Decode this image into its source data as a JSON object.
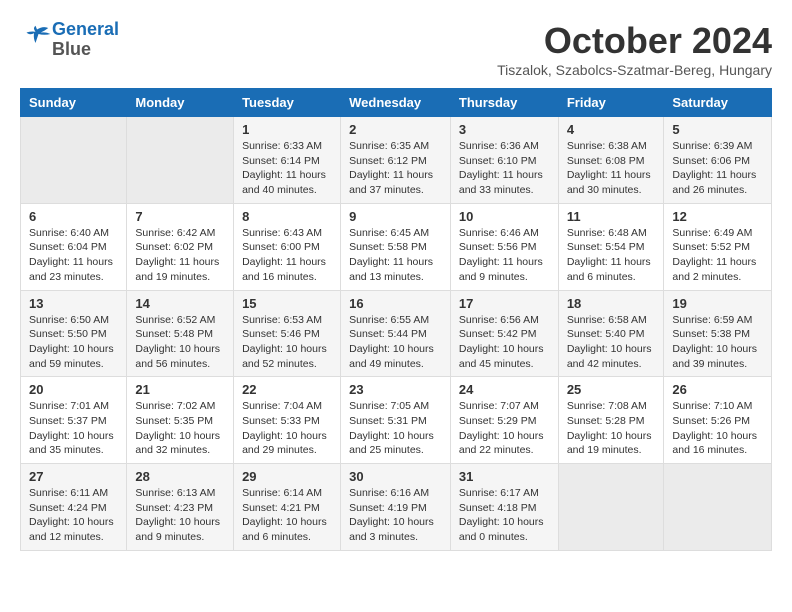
{
  "header": {
    "logo_line1": "General",
    "logo_line2": "Blue",
    "month_title": "October 2024",
    "location": "Tiszalok, Szabolcs-Szatmar-Bereg, Hungary"
  },
  "columns": [
    "Sunday",
    "Monday",
    "Tuesday",
    "Wednesday",
    "Thursday",
    "Friday",
    "Saturday"
  ],
  "weeks": [
    [
      {
        "day": "",
        "empty": true
      },
      {
        "day": "",
        "empty": true
      },
      {
        "day": "1",
        "sunrise": "Sunrise: 6:33 AM",
        "sunset": "Sunset: 6:14 PM",
        "daylight": "Daylight: 11 hours and 40 minutes."
      },
      {
        "day": "2",
        "sunrise": "Sunrise: 6:35 AM",
        "sunset": "Sunset: 6:12 PM",
        "daylight": "Daylight: 11 hours and 37 minutes."
      },
      {
        "day": "3",
        "sunrise": "Sunrise: 6:36 AM",
        "sunset": "Sunset: 6:10 PM",
        "daylight": "Daylight: 11 hours and 33 minutes."
      },
      {
        "day": "4",
        "sunrise": "Sunrise: 6:38 AM",
        "sunset": "Sunset: 6:08 PM",
        "daylight": "Daylight: 11 hours and 30 minutes."
      },
      {
        "day": "5",
        "sunrise": "Sunrise: 6:39 AM",
        "sunset": "Sunset: 6:06 PM",
        "daylight": "Daylight: 11 hours and 26 minutes."
      }
    ],
    [
      {
        "day": "6",
        "sunrise": "Sunrise: 6:40 AM",
        "sunset": "Sunset: 6:04 PM",
        "daylight": "Daylight: 11 hours and 23 minutes."
      },
      {
        "day": "7",
        "sunrise": "Sunrise: 6:42 AM",
        "sunset": "Sunset: 6:02 PM",
        "daylight": "Daylight: 11 hours and 19 minutes."
      },
      {
        "day": "8",
        "sunrise": "Sunrise: 6:43 AM",
        "sunset": "Sunset: 6:00 PM",
        "daylight": "Daylight: 11 hours and 16 minutes."
      },
      {
        "day": "9",
        "sunrise": "Sunrise: 6:45 AM",
        "sunset": "Sunset: 5:58 PM",
        "daylight": "Daylight: 11 hours and 13 minutes."
      },
      {
        "day": "10",
        "sunrise": "Sunrise: 6:46 AM",
        "sunset": "Sunset: 5:56 PM",
        "daylight": "Daylight: 11 hours and 9 minutes."
      },
      {
        "day": "11",
        "sunrise": "Sunrise: 6:48 AM",
        "sunset": "Sunset: 5:54 PM",
        "daylight": "Daylight: 11 hours and 6 minutes."
      },
      {
        "day": "12",
        "sunrise": "Sunrise: 6:49 AM",
        "sunset": "Sunset: 5:52 PM",
        "daylight": "Daylight: 11 hours and 2 minutes."
      }
    ],
    [
      {
        "day": "13",
        "sunrise": "Sunrise: 6:50 AM",
        "sunset": "Sunset: 5:50 PM",
        "daylight": "Daylight: 10 hours and 59 minutes."
      },
      {
        "day": "14",
        "sunrise": "Sunrise: 6:52 AM",
        "sunset": "Sunset: 5:48 PM",
        "daylight": "Daylight: 10 hours and 56 minutes."
      },
      {
        "day": "15",
        "sunrise": "Sunrise: 6:53 AM",
        "sunset": "Sunset: 5:46 PM",
        "daylight": "Daylight: 10 hours and 52 minutes."
      },
      {
        "day": "16",
        "sunrise": "Sunrise: 6:55 AM",
        "sunset": "Sunset: 5:44 PM",
        "daylight": "Daylight: 10 hours and 49 minutes."
      },
      {
        "day": "17",
        "sunrise": "Sunrise: 6:56 AM",
        "sunset": "Sunset: 5:42 PM",
        "daylight": "Daylight: 10 hours and 45 minutes."
      },
      {
        "day": "18",
        "sunrise": "Sunrise: 6:58 AM",
        "sunset": "Sunset: 5:40 PM",
        "daylight": "Daylight: 10 hours and 42 minutes."
      },
      {
        "day": "19",
        "sunrise": "Sunrise: 6:59 AM",
        "sunset": "Sunset: 5:38 PM",
        "daylight": "Daylight: 10 hours and 39 minutes."
      }
    ],
    [
      {
        "day": "20",
        "sunrise": "Sunrise: 7:01 AM",
        "sunset": "Sunset: 5:37 PM",
        "daylight": "Daylight: 10 hours and 35 minutes."
      },
      {
        "day": "21",
        "sunrise": "Sunrise: 7:02 AM",
        "sunset": "Sunset: 5:35 PM",
        "daylight": "Daylight: 10 hours and 32 minutes."
      },
      {
        "day": "22",
        "sunrise": "Sunrise: 7:04 AM",
        "sunset": "Sunset: 5:33 PM",
        "daylight": "Daylight: 10 hours and 29 minutes."
      },
      {
        "day": "23",
        "sunrise": "Sunrise: 7:05 AM",
        "sunset": "Sunset: 5:31 PM",
        "daylight": "Daylight: 10 hours and 25 minutes."
      },
      {
        "day": "24",
        "sunrise": "Sunrise: 7:07 AM",
        "sunset": "Sunset: 5:29 PM",
        "daylight": "Daylight: 10 hours and 22 minutes."
      },
      {
        "day": "25",
        "sunrise": "Sunrise: 7:08 AM",
        "sunset": "Sunset: 5:28 PM",
        "daylight": "Daylight: 10 hours and 19 minutes."
      },
      {
        "day": "26",
        "sunrise": "Sunrise: 7:10 AM",
        "sunset": "Sunset: 5:26 PM",
        "daylight": "Daylight: 10 hours and 16 minutes."
      }
    ],
    [
      {
        "day": "27",
        "sunrise": "Sunrise: 6:11 AM",
        "sunset": "Sunset: 4:24 PM",
        "daylight": "Daylight: 10 hours and 12 minutes."
      },
      {
        "day": "28",
        "sunrise": "Sunrise: 6:13 AM",
        "sunset": "Sunset: 4:23 PM",
        "daylight": "Daylight: 10 hours and 9 minutes."
      },
      {
        "day": "29",
        "sunrise": "Sunrise: 6:14 AM",
        "sunset": "Sunset: 4:21 PM",
        "daylight": "Daylight: 10 hours and 6 minutes."
      },
      {
        "day": "30",
        "sunrise": "Sunrise: 6:16 AM",
        "sunset": "Sunset: 4:19 PM",
        "daylight": "Daylight: 10 hours and 3 minutes."
      },
      {
        "day": "31",
        "sunrise": "Sunrise: 6:17 AM",
        "sunset": "Sunset: 4:18 PM",
        "daylight": "Daylight: 10 hours and 0 minutes."
      },
      {
        "day": "",
        "empty": true
      },
      {
        "day": "",
        "empty": true
      }
    ]
  ]
}
